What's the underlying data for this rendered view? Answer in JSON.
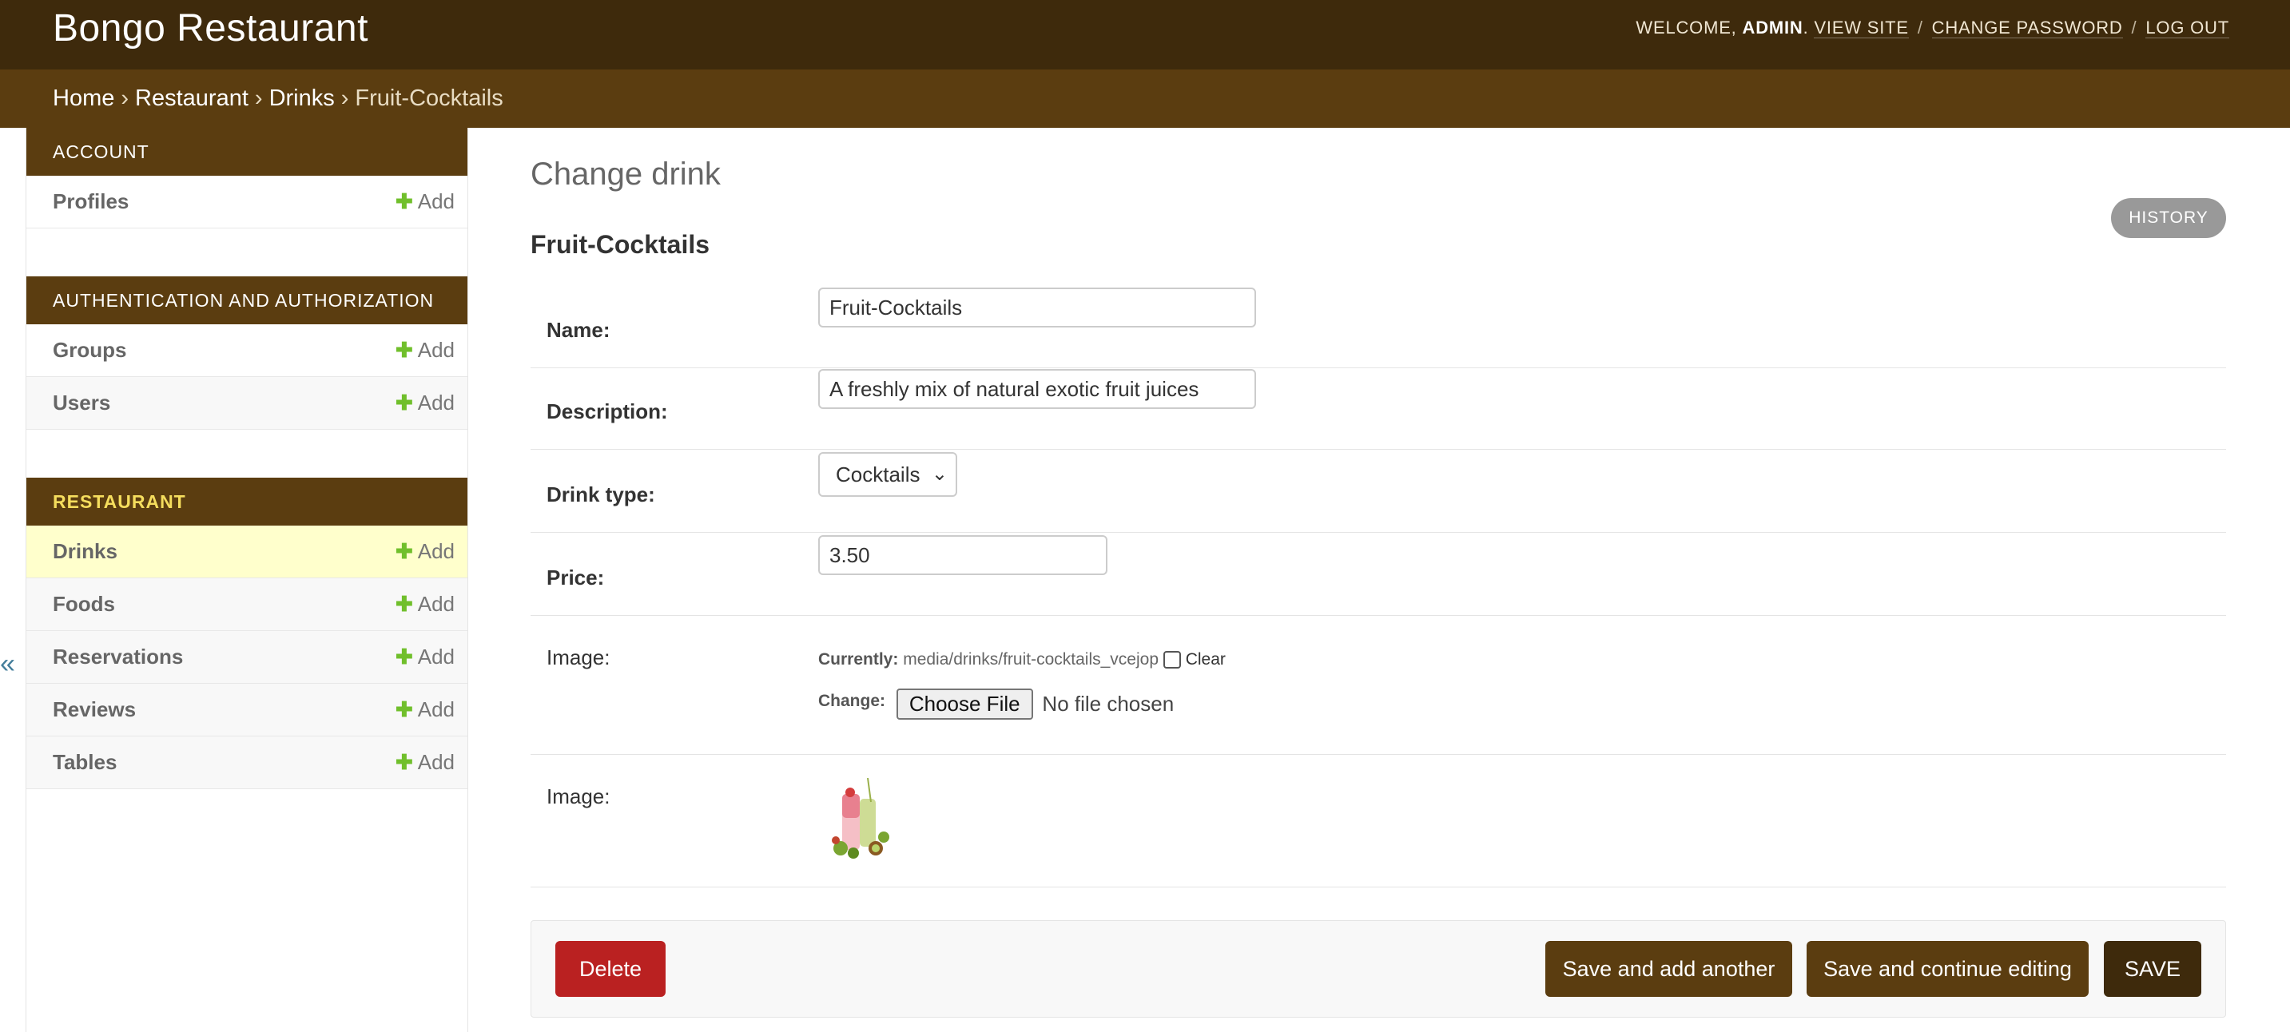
{
  "header": {
    "site_name": "Bongo Restaurant",
    "welcome": "WELCOME,",
    "username": "ADMIN",
    "view_site": "VIEW SITE",
    "change_password": "CHANGE PASSWORD",
    "log_out": "LOG OUT"
  },
  "breadcrumbs": [
    "Home",
    "Restaurant",
    "Drinks",
    "Fruit-Cocktails"
  ],
  "sidebar": {
    "toggle": "«",
    "add_label": "Add",
    "modules": [
      {
        "caption": "ACCOUNT",
        "models": [
          "Profiles"
        ]
      },
      {
        "caption": "AUTHENTICATION AND AUTHORIZATION",
        "models": [
          "Groups",
          "Users"
        ]
      },
      {
        "caption": "RESTAURANT",
        "models": [
          "Drinks",
          "Foods",
          "Reservations",
          "Reviews",
          "Tables"
        ]
      }
    ]
  },
  "main": {
    "title": "Change drink",
    "history": "HISTORY",
    "object_title": "Fruit-Cocktails",
    "fields": {
      "name": {
        "label": "Name:",
        "value": "Fruit-Cocktails"
      },
      "description": {
        "label": "Description:",
        "value": "A freshly mix of natural exotic fruit juices"
      },
      "drink_type": {
        "label": "Drink type:",
        "value": "Cocktails"
      },
      "price": {
        "label": "Price:",
        "value": "3.50"
      },
      "image": {
        "label": "Image:",
        "currently_label": "Currently:",
        "currently_value": "media/drinks/fruit-cocktails_vcejop",
        "clear_label": "Clear",
        "change_label": "Change:",
        "choose_file": "Choose File",
        "no_file": "No file chosen"
      },
      "image_preview": {
        "label": "Image:"
      }
    },
    "buttons": {
      "delete": "Delete",
      "save_add_another": "Save and add another",
      "save_continue": "Save and continue editing",
      "save": "SAVE"
    }
  },
  "colors": {
    "header_bg": "#3e2a0c",
    "breadcrumb_bg": "#5b3d10",
    "delete_red": "#ba2121",
    "current_row": "#ffffcc",
    "add_plus": "#70bf2b"
  }
}
